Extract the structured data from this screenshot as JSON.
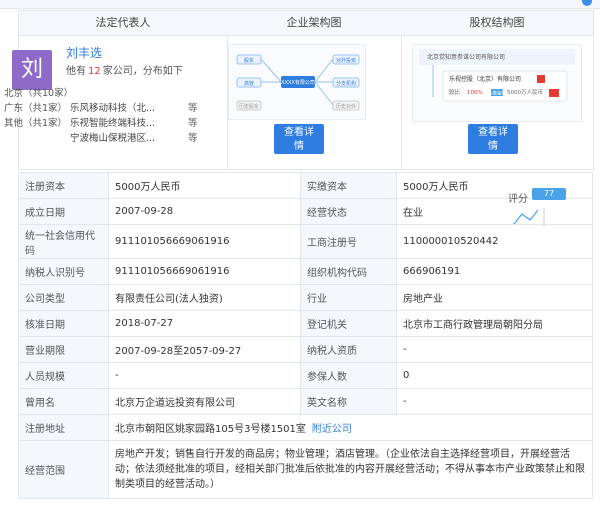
{
  "header": {
    "col1_title": "法定代表人",
    "col2_title": "企业架构图",
    "col3_title": "股权结构图"
  },
  "rep": {
    "avatar_char": "刘",
    "name": "刘丰选",
    "stats_prefix": "他有",
    "count": "12",
    "stats_suffix": "家公司，分布如下",
    "dist": [
      {
        "region": "北京（共10家）",
        "company": "",
        "etc": ""
      },
      {
        "region": "广东（共1家）",
        "company": "乐风移动科技（北...",
        "etc": "等"
      },
      {
        "region": "其他（共1家）",
        "company": "乐视智能终端科技...",
        "etc": "等"
      },
      {
        "region": "",
        "company": "宁波梅山保税港区...",
        "etc": "等"
      }
    ]
  },
  "diagram": {
    "center_label": "XXXX有限公司",
    "left_labels": [
      "股东",
      "高管",
      "历史股东"
    ],
    "right_labels": [
      "对外投资",
      "分支机构",
      "历史对外"
    ]
  },
  "equity": {
    "company": "北京觉知意参谋公司有限公司",
    "holder": "乐视控股（北京）有限公司",
    "share_label": "股比",
    "share": "100%",
    "capital_label": "认缴金额",
    "capital": "5000万人民币"
  },
  "buttons": {
    "detail": "查看详情"
  },
  "score": {
    "label": "评分",
    "badge": "77"
  },
  "table": [
    [
      "注册资本",
      "5000万人民币",
      "实缴资本",
      "5000万人民币"
    ],
    [
      "成立日期",
      "2007-09-28",
      "经营状态",
      "在业"
    ],
    [
      "统一社会信用代码",
      "911101056669061916",
      "工商注册号",
      "110000010520442"
    ],
    [
      "纳税人识别号",
      "911101056669061916",
      "组织机构代码",
      "666906191"
    ],
    [
      "公司类型",
      "有限责任公司(法人独资)",
      "行业",
      "房地产业"
    ],
    [
      "核准日期",
      "2018-07-27",
      "登记机关",
      "北京市工商行政管理局朝阳分局"
    ],
    [
      "营业期限",
      "2007-09-28至2057-09-27",
      "纳税人资质",
      "-"
    ],
    [
      "人员规模",
      "-",
      "参保人数",
      "0"
    ],
    [
      "曾用名",
      "北京万企道远投资有限公司",
      "英文名称",
      "-"
    ]
  ],
  "address": {
    "label": "注册地址",
    "value": "北京市朝阳区姚家园路105号3号楼1501室",
    "link": "附近公司"
  },
  "scope": {
    "label": "经营范围",
    "value": "房地产开发；销售自行开发的商品房；物业管理；酒店管理。（企业依法自主选择经营项目，开展经营活动；依法须经批准的项目，经相关部门批准后依批准的内容开展经营活动；不得从事本市产业政策禁止和限制类项目的经营活动。）"
  }
}
